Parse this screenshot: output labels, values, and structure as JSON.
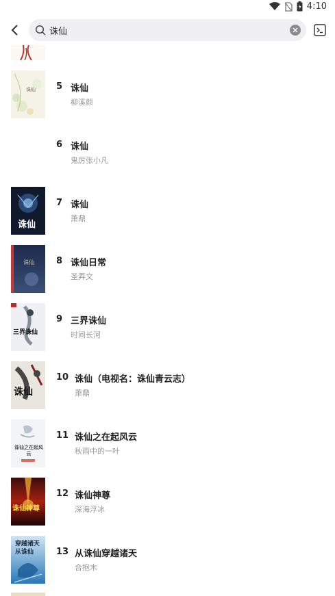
{
  "status_bar": {
    "time": "4:10",
    "icons": [
      "wifi-icon",
      "no-sim-icon",
      "battery-icon"
    ]
  },
  "search": {
    "query": "诛仙",
    "icons": [
      "back-arrow-icon",
      "search-icon",
      "clear-icon",
      "terminal-icon"
    ]
  },
  "results": [
    {
      "rank": "5",
      "title": "诛仙",
      "author": "柳溪颜",
      "cover": "floral-cover"
    },
    {
      "rank": "6",
      "title": "诛仙",
      "author": "鬼厉张小凡",
      "cover": "no-cover"
    },
    {
      "rank": "7",
      "title": "诛仙",
      "author": "萧鼎",
      "cover": "dark-blue-cover",
      "cover_text": "诛仙"
    },
    {
      "rank": "8",
      "title": "诛仙日常",
      "author": "圣弄文",
      "cover": "navy-cover"
    },
    {
      "rank": "9",
      "title": "三界诛仙",
      "author": "时间长河",
      "cover": "warrior-cover",
      "cover_text": "三界诛仙"
    },
    {
      "rank": "10",
      "title": "诛仙（电视名：诛仙青云志）",
      "author": "萧鼎",
      "cover": "ink-cover",
      "cover_text": "诛仙"
    },
    {
      "rank": "11",
      "title": "诛仙之在起风云",
      "author": "秋雨中的一叶",
      "cover": "light-cover",
      "cover_text": "诛仙之在起风云"
    },
    {
      "rank": "12",
      "title": "诛仙神尊",
      "author": "深海浮冰",
      "cover": "fire-cover",
      "cover_text": "诛仙神尊"
    },
    {
      "rank": "13",
      "title": "从诛仙穿越诸天",
      "author": "合抱木",
      "cover": "blue-sky-cover",
      "cover_text": "穿越诸天 从诛仙"
    }
  ],
  "colors": {
    "search_bg": "#f0f0f2",
    "title": "#222222",
    "author": "#999999"
  }
}
